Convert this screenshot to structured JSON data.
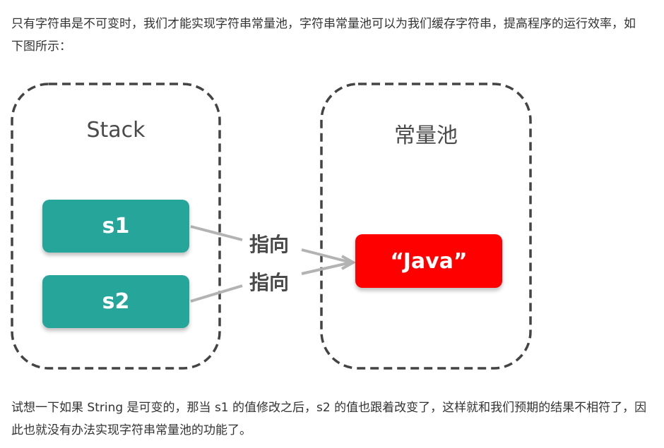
{
  "intro_text": "只有字符串是不可变时，我们才能实现字符串常量池，字符串常量池可以为我们缓存字符串，提高程序的运行效率，如下图所示：",
  "diagram": {
    "stack_title": "Stack",
    "pool_title": "常量池",
    "stack_items": [
      "s1",
      "s2"
    ],
    "pool_value": "“Java”",
    "pointer_labels": [
      "指向",
      "指向"
    ],
    "colors": {
      "stack_item": "#26a69a",
      "pool_value": "#ff0000",
      "border": "#444444",
      "arrow": "#b3b3b3"
    }
  },
  "outro_text": "试想一下如果 String 是可变的，那当 s1 的值修改之后，s2 的值也跟着改变了，这样就和我们预期的结果不相符了，因此也就没有办法实现字符串常量池的功能了。"
}
